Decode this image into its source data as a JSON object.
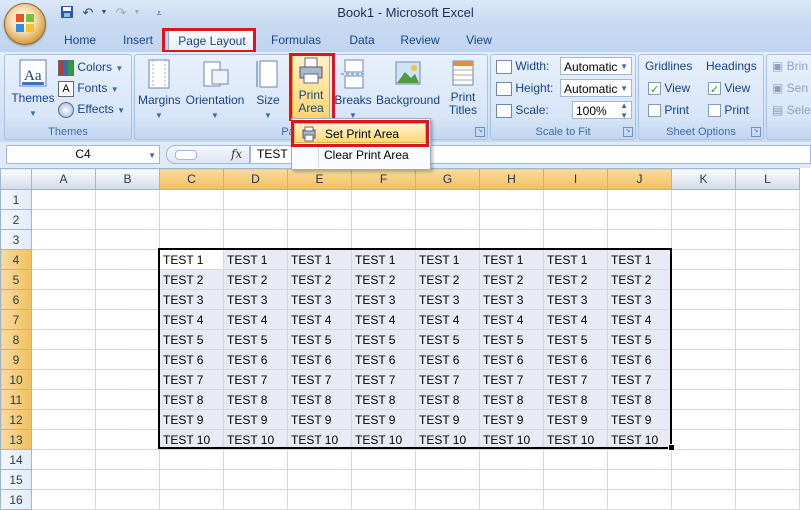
{
  "window": {
    "title": "Book1 - Microsoft Excel"
  },
  "tabs": [
    "Home",
    "Insert",
    "Page Layout",
    "Formulas",
    "Data",
    "Review",
    "View"
  ],
  "ribbon": {
    "themes": {
      "themes_label": "Themes",
      "colors_label": "Colors",
      "fonts_label": "Fonts",
      "effects_label": "Effects",
      "group_label": "Themes"
    },
    "page_setup": {
      "margins_label": "Margins",
      "orientation_label": "Orientation",
      "size_label": "Size",
      "print_area_line1": "Print",
      "print_area_line2": "Area",
      "breaks_label": "Breaks",
      "background_label": "Background",
      "print_titles_line1": "Print",
      "print_titles_line2": "Titles",
      "group_label_partial": "Pag"
    },
    "scale_to_fit": {
      "width_label": "Width:",
      "width_value": "Automatic",
      "height_label": "Height:",
      "height_value": "Automatic",
      "scale_label": "Scale:",
      "scale_value": "100%",
      "group_label": "Scale to Fit"
    },
    "sheet_options": {
      "gridlines_label": "Gridlines",
      "headings_label": "Headings",
      "view_label": "View",
      "print_label": "Print",
      "gridlines_view": true,
      "gridlines_print": false,
      "headings_view": true,
      "headings_print": false,
      "group_label": "Sheet Options"
    },
    "arrange": {
      "bring_label": "Brin",
      "send_label": "Sen",
      "select_label": "Sele"
    }
  },
  "print_area_menu": {
    "set_label": "Set Print Area",
    "clear_label": "Clear Print Area"
  },
  "formula_bar": {
    "name_box": "C4",
    "fx_label": "fx",
    "content": "TEST 1"
  },
  "grid": {
    "columns": [
      "A",
      "B",
      "C",
      "D",
      "E",
      "F",
      "G",
      "H",
      "I",
      "J",
      "K",
      "L"
    ],
    "rows": [
      "1",
      "2",
      "3",
      "4",
      "5",
      "6",
      "7",
      "8",
      "9",
      "10",
      "11",
      "12",
      "13",
      "14",
      "15",
      "16"
    ],
    "selected_columns": [
      "C",
      "D",
      "E",
      "F",
      "G",
      "H",
      "I",
      "J"
    ],
    "selected_rows": [
      "4",
      "5",
      "6",
      "7",
      "8",
      "9",
      "10",
      "11",
      "12",
      "13"
    ],
    "data_start_row": 4,
    "data_start_col": 2,
    "data": [
      [
        "TEST 1",
        "TEST 1",
        "TEST 1",
        "TEST 1",
        "TEST 1",
        "TEST 1",
        "TEST 1",
        "TEST 1"
      ],
      [
        "TEST 2",
        "TEST 2",
        "TEST 2",
        "TEST 2",
        "TEST 2",
        "TEST 2",
        "TEST 2",
        "TEST 2"
      ],
      [
        "TEST 3",
        "TEST 3",
        "TEST 3",
        "TEST 3",
        "TEST 3",
        "TEST 3",
        "TEST 3",
        "TEST 3"
      ],
      [
        "TEST 4",
        "TEST 4",
        "TEST 4",
        "TEST 4",
        "TEST 4",
        "TEST 4",
        "TEST 4",
        "TEST 4"
      ],
      [
        "TEST 5",
        "TEST 5",
        "TEST 5",
        "TEST 5",
        "TEST 5",
        "TEST 5",
        "TEST 5",
        "TEST 5"
      ],
      [
        "TEST 6",
        "TEST 6",
        "TEST 6",
        "TEST 6",
        "TEST 6",
        "TEST 6",
        "TEST 6",
        "TEST 6"
      ],
      [
        "TEST 7",
        "TEST 7",
        "TEST 7",
        "TEST 7",
        "TEST 7",
        "TEST 7",
        "TEST 7",
        "TEST 7"
      ],
      [
        "TEST 8",
        "TEST 8",
        "TEST 8",
        "TEST 8",
        "TEST 8",
        "TEST 8",
        "TEST 8",
        "TEST 8"
      ],
      [
        "TEST 9",
        "TEST 9",
        "TEST 9",
        "TEST 9",
        "TEST 9",
        "TEST 9",
        "TEST 9",
        "TEST 9"
      ],
      [
        "TEST 10",
        "TEST 10",
        "TEST 10",
        "TEST 10",
        "TEST 10",
        "TEST 10",
        "TEST 10",
        "TEST 10"
      ]
    ]
  },
  "colors": {
    "highlight_red": "#e0141c",
    "selected_header": "#f1c15f",
    "ribbon_blue": "#d5e3f6"
  }
}
